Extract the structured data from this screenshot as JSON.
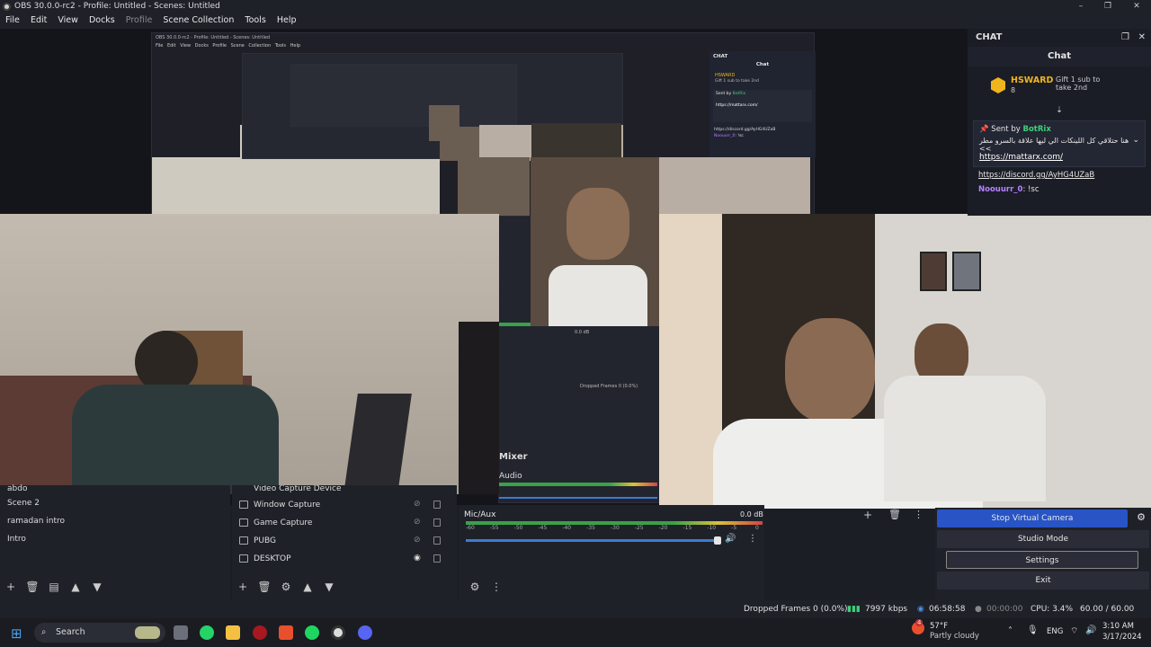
{
  "window": {
    "title": "OBS 30.0.0-rc2 - Profile: Untitled - Scenes: Untitled",
    "minimize": "–",
    "maximize": "❐",
    "close": "✕"
  },
  "menu": [
    {
      "label": "File",
      "dim": false
    },
    {
      "label": "Edit",
      "dim": false
    },
    {
      "label": "View",
      "dim": false
    },
    {
      "label": "Docks",
      "dim": false
    },
    {
      "label": "Profile",
      "dim": true
    },
    {
      "label": "Scene Collection",
      "dim": false
    },
    {
      "label": "Tools",
      "dim": false
    },
    {
      "label": "Help",
      "dim": false
    }
  ],
  "chat_dock": {
    "title": "CHAT",
    "subtitle": "Chat",
    "gifter_name": "HSWARD",
    "gifter_count": "8",
    "gift_text": "Gift 1 sub to take 2nd",
    "pinned_label": "Sent by",
    "pinned_user": "BotRix",
    "pinned_msg": "هنا حتلاقي كل اللينكات الي ليها علاقة بالسرو مطر >>",
    "pinned_link": "https://mattarx.com/",
    "msg1_link": "https://discord.gg/AyHG4UZaB",
    "msg2_user": "Noouurr_0",
    "msg2_text": ": !sc"
  },
  "scenes": {
    "items": [
      "abdo",
      "Scene 2",
      "ramadan intro",
      "Intro"
    ]
  },
  "sources": {
    "items": [
      {
        "label": "Video Capture Device",
        "visible": true
      },
      {
        "label": "Window Capture",
        "visible": false
      },
      {
        "label": "Game Capture",
        "visible": false
      },
      {
        "label": "PUBG",
        "visible": false
      },
      {
        "label": "DESKTOP",
        "visible": true
      }
    ]
  },
  "mixer": {
    "title": "Mixer",
    "desktop_label": "Audio",
    "mic_label": "Mic/Aux",
    "mic_level": "0.0 dB",
    "ticks": [
      "-60",
      "-55",
      "-50",
      "-45",
      "-40",
      "-35",
      "-30",
      "-25",
      "-20",
      "-15",
      "-10",
      "-5",
      "0"
    ],
    "mic_volume_fraction": 1.0
  },
  "controls": {
    "stop_virtual_camera": "Stop Virtual Camera",
    "studio_mode": "Studio Mode",
    "settings": "Settings",
    "exit": "Exit"
  },
  "status": {
    "dropped": "Dropped Frames 0 (0.0%)",
    "bitrate": "7997 kbps",
    "rec_time": "06:58:58",
    "stream_time": "00:00:00",
    "cpu": "CPU: 3.4%",
    "fps": "60.00 / 60.00 FPS"
  },
  "nested": {
    "dropped": "Dropped Frames 0 (0.0%)",
    "level": "0.0 dB",
    "mini_chat_title": "CHAT",
    "mini_chat_sub": "Chat",
    "mini_gifter": "HSWARD",
    "mini_gift": "Gift 1 sub to take 2nd",
    "mini_sent": "Sent by",
    "mini_user": "BotRix",
    "mini_link": "https://mattarx.com/",
    "mini_discord": "https://discord.gg/AyHG4UZaB",
    "mini_user2": "Noouurr_0",
    "mini_msg2": ": !sc"
  },
  "taskbar": {
    "search": "Search",
    "weather_temp": "57°F",
    "weather_desc": "Partly cloudy",
    "lang": "ENG",
    "time": "3:10 AM",
    "date": "3/17/2024",
    "badge": "4"
  }
}
